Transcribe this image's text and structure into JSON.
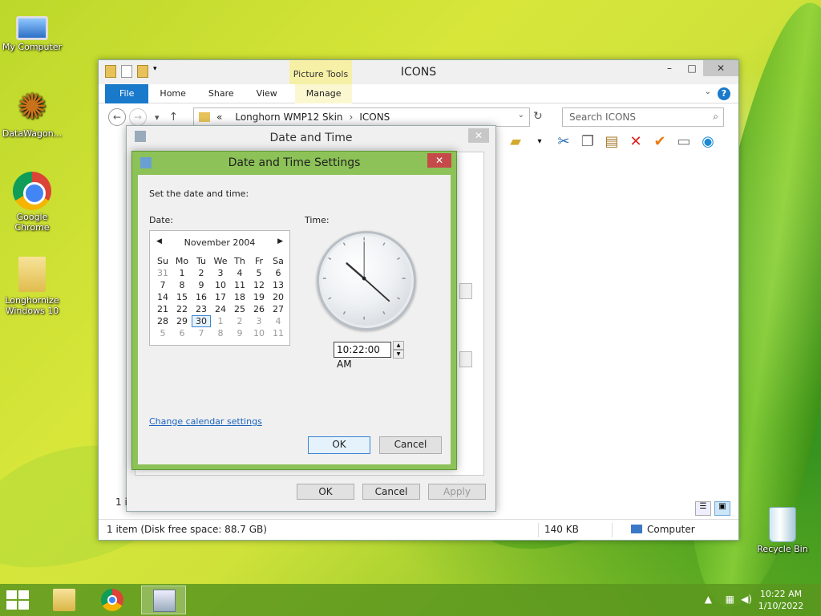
{
  "desktop": {
    "icons": [
      {
        "label": "My Computer",
        "icon": "computer-icon"
      },
      {
        "label": "DataWagon...",
        "icon": "datawagon-icon"
      },
      {
        "label": "Google Chrome",
        "icon": "chrome-icon"
      },
      {
        "label": "Longhornize Windows 10",
        "icon": "folder-icon"
      },
      {
        "label": "Recycle Bin",
        "icon": "recycle-bin-icon"
      }
    ]
  },
  "explorer": {
    "title": "ICONS",
    "contextual_tab": "Picture Tools",
    "tabs": [
      "File",
      "Home",
      "Share",
      "View",
      "Manage"
    ],
    "address": {
      "prefix": "«",
      "parts": [
        "Longhorn WMP12 Skin",
        "ICONS"
      ]
    },
    "search_placeholder": "Search ICONS",
    "status": {
      "items": "1 item (Disk free space: 88.7 GB)",
      "size": "140 KB",
      "location": "Computer"
    },
    "partial_text": "1 i"
  },
  "date_time": {
    "title": "Date and Time",
    "buttons": {
      "ok": "OK",
      "cancel": "Cancel",
      "apply": "Apply"
    }
  },
  "settings": {
    "title": "Date and Time Settings",
    "instruction": "Set the date and time:",
    "date_label": "Date:",
    "time_label": "Time:",
    "calendar": {
      "month_year": "November 2004",
      "weekdays": [
        "Su",
        "Mo",
        "Tu",
        "We",
        "Th",
        "Fr",
        "Sa"
      ],
      "weeks": [
        [
          "31",
          "1",
          "2",
          "3",
          "4",
          "5",
          "6"
        ],
        [
          "7",
          "8",
          "9",
          "10",
          "11",
          "12",
          "13"
        ],
        [
          "14",
          "15",
          "16",
          "17",
          "18",
          "19",
          "20"
        ],
        [
          "21",
          "22",
          "23",
          "24",
          "25",
          "26",
          "27"
        ],
        [
          "28",
          "29",
          "30",
          "1",
          "2",
          "3",
          "4"
        ],
        [
          "5",
          "6",
          "7",
          "8",
          "9",
          "10",
          "11"
        ]
      ],
      "selected": "30"
    },
    "clock": {
      "hour": 10,
      "minute": 22,
      "second": 0
    },
    "time_value": "10:22:00 AM",
    "link": "Change calendar settings",
    "ok": "OK",
    "cancel": "Cancel"
  },
  "taskbar": {
    "time": "10:22 AM",
    "date": "1/10/2022",
    "apps": [
      "file-explorer-icon",
      "chrome-icon",
      "date-time-icon"
    ]
  }
}
